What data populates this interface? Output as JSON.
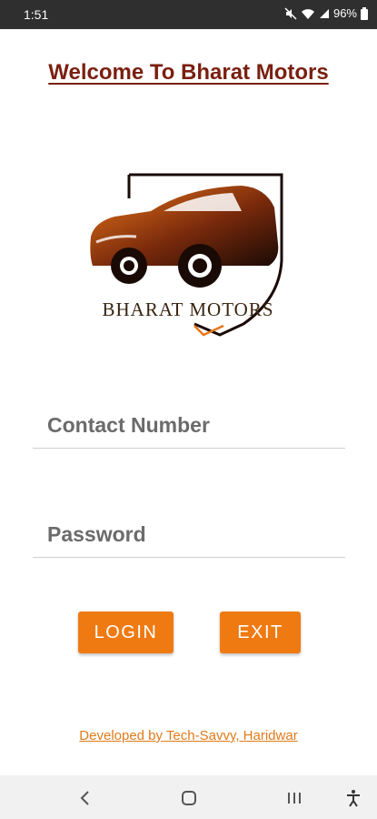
{
  "status_bar": {
    "time": "1:51",
    "battery": "96%",
    "icons": [
      "mute-icon",
      "wifi-icon",
      "signal-icon",
      "battery-icon"
    ]
  },
  "header": {
    "welcome_title": "Welcome To Bharat Motors"
  },
  "logo": {
    "brand_text": "BHARAT MOTORS",
    "icon": "car-shield-logo"
  },
  "form": {
    "contact_placeholder": "Contact Number",
    "password_placeholder": "Password",
    "contact_value": "",
    "password_value": ""
  },
  "buttons": {
    "login_label": "LOGIN",
    "exit_label": "EXIT"
  },
  "footer": {
    "credit_text": "Developed by Tech-Savvy, Haridwar"
  },
  "navigation": {
    "icons": [
      "back-icon",
      "home-icon",
      "recents-icon",
      "accessibility-icon"
    ]
  },
  "colors": {
    "accent": "#ef7a12",
    "title": "#7a1f10",
    "footer_link": "#e07a18",
    "status_bar_bg": "#2f2f2f"
  }
}
